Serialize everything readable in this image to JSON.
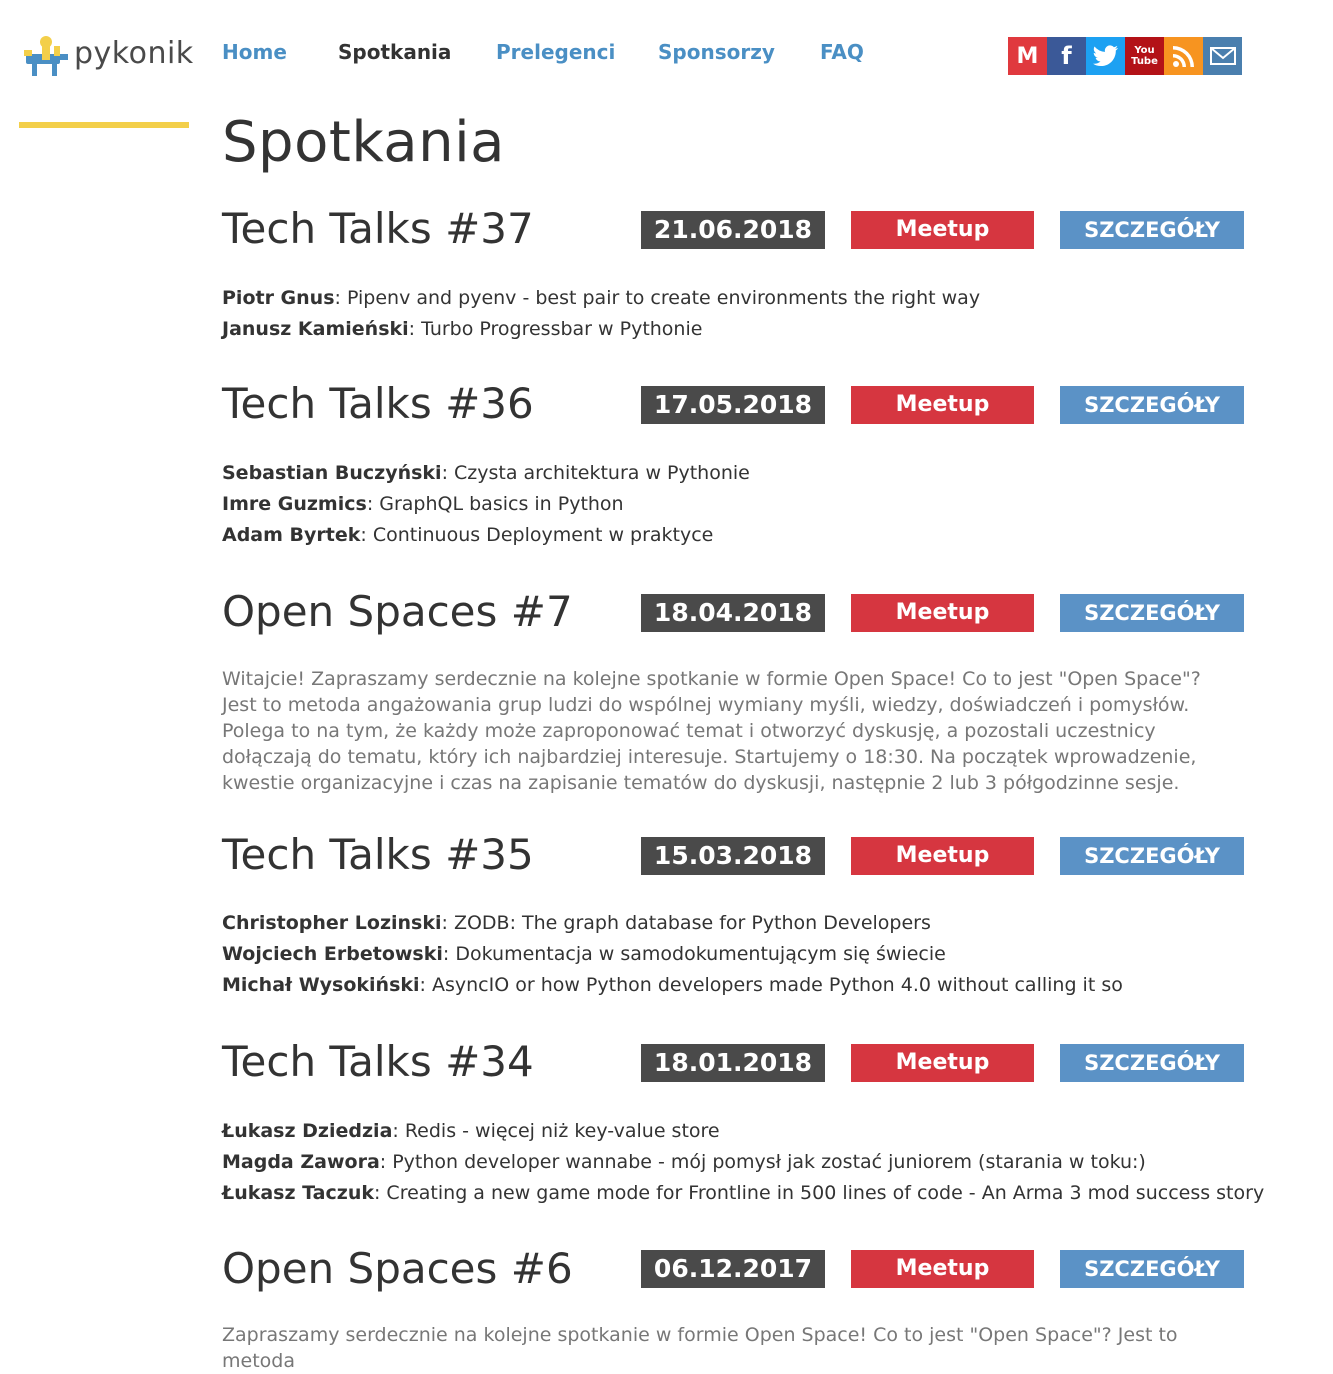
{
  "logo": {
    "text": "pykonik"
  },
  "nav": [
    {
      "label": "Home",
      "active": false
    },
    {
      "label": "Spotkania",
      "active": true
    },
    {
      "label": "Prelegenci",
      "active": false
    },
    {
      "label": "Sponsorzy",
      "active": false
    },
    {
      "label": "FAQ",
      "active": false
    }
  ],
  "social": [
    {
      "icon": "meetup-icon",
      "glyph": "M",
      "color": "#e0393e"
    },
    {
      "icon": "facebook-icon",
      "glyph": "f",
      "color": "#3b5998"
    },
    {
      "icon": "twitter-icon",
      "glyph": "",
      "color": "#1da1f2"
    },
    {
      "icon": "youtube-icon",
      "glyph": "You Tube",
      "color": "#b31217"
    },
    {
      "icon": "rss-icon",
      "glyph": "",
      "color": "#f79420"
    },
    {
      "icon": "email-icon",
      "glyph": "",
      "color": "#4a7fae"
    }
  ],
  "page_title": "Spotkania",
  "labels": {
    "details": "SZCZEGÓŁY"
  },
  "colors": {
    "accent": "#f3cf4a",
    "link": "#4a8fc4",
    "meetup": "#d63640",
    "date": "#4a4a4a",
    "details": "#5b92c6"
  },
  "events": [
    {
      "title": "Tech Talks #37",
      "date": "21.06.2018",
      "type": "Meetup",
      "talks": [
        {
          "speaker": "Piotr Gnus",
          "title": ": Pipenv and pyenv - best pair to create environments the right way"
        },
        {
          "speaker": "Janusz Kamieński",
          "title": ": Turbo Progressbar w Pythonie"
        }
      ]
    },
    {
      "title": "Tech Talks #36",
      "date": "17.05.2018",
      "type": "Meetup",
      "talks": [
        {
          "speaker": "Sebastian Buczyński",
          "title": ": Czysta architektura w Pythonie"
        },
        {
          "speaker": "Imre Guzmics",
          "title": ": GraphQL basics in Python"
        },
        {
          "speaker": "Adam Byrtek",
          "title": ": Continuous Deployment w praktyce"
        }
      ]
    },
    {
      "title": "Open Spaces #7",
      "date": "18.04.2018",
      "type": "Meetup",
      "description": "Witajcie! Zapraszamy serdecznie na kolejne spotkanie w formie Open Space! Co to jest \"Open Space\"? Jest to metoda angażowania grup ludzi do wspólnej wymiany myśli, wiedzy, doświadczeń i pomysłów. Polega to na tym, że każdy może zaproponować temat i otworzyć dyskusję, a pozostali uczestnicy dołączają do tematu, który ich najbardziej interesuje. Startujemy o 18:30. Na początek wprowadzenie, kwestie organizacyjne i czas na zapisanie tematów do dyskusji, następnie 2 lub 3 półgodzinne sesje."
    },
    {
      "title": "Tech Talks #35",
      "date": "15.03.2018",
      "type": "Meetup",
      "talks": [
        {
          "speaker": "Christopher Lozinski",
          "title": ": ZODB: The graph database for Python Developers"
        },
        {
          "speaker": "Wojciech Erbetowski",
          "title": ": Dokumentacja w samodokumentującym się świecie"
        },
        {
          "speaker": "Michał Wysokiński",
          "title": ": AsyncIO or how Python developers made Python 4.0 without calling it so"
        }
      ]
    },
    {
      "title": "Tech Talks #34",
      "date": "18.01.2018",
      "type": "Meetup",
      "talks": [
        {
          "speaker": "Łukasz Dziedzia",
          "title": ": Redis - więcej niż key-value store"
        },
        {
          "speaker": "Magda Zawora",
          "title": ": Python developer wannabe - mój pomysł jak zostać juniorem (starania w toku:)"
        },
        {
          "speaker": "Łukasz Taczuk",
          "title": ": Creating a new game mode for Frontline in 500 lines of code - An Arma 3 mod success story"
        }
      ]
    },
    {
      "title": "Open Spaces #6",
      "date": "06.12.2017",
      "type": "Meetup",
      "description": "Zapraszamy serdecznie na kolejne spotkanie w formie Open Space! Co to jest \"Open Space\"? Jest to metoda"
    }
  ]
}
